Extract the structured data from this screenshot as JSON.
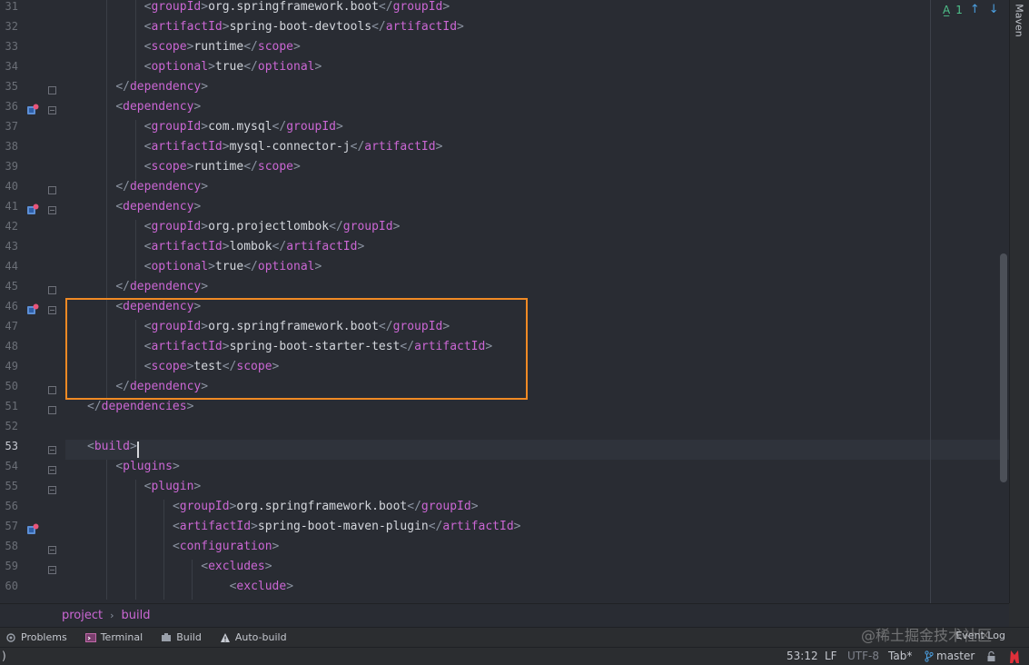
{
  "editor": {
    "line_numbers": [
      "31",
      "32",
      "33",
      "34",
      "35",
      "36",
      "37",
      "38",
      "39",
      "40",
      "41",
      "42",
      "43",
      "44",
      "45",
      "46",
      "47",
      "48",
      "49",
      "50",
      "51",
      "52",
      "53",
      "54",
      "55",
      "56",
      "57",
      "58",
      "59",
      "60"
    ],
    "current_line": "53",
    "lines": [
      {
        "indent": 2,
        "open": "groupId",
        "text": "org.springframework.boot"
      },
      {
        "indent": 2,
        "open": "artifactId",
        "text": "spring-boot-devtools"
      },
      {
        "indent": 2,
        "open": "scope",
        "text": "runtime"
      },
      {
        "indent": 2,
        "open": "optional",
        "text": "true"
      },
      {
        "indent": 1,
        "close_only": "dependency"
      },
      {
        "indent": 1,
        "open_only": "dependency"
      },
      {
        "indent": 2,
        "open": "groupId",
        "text": "com.mysql"
      },
      {
        "indent": 2,
        "open": "artifactId",
        "text": "mysql-connector-j"
      },
      {
        "indent": 2,
        "open": "scope",
        "text": "runtime"
      },
      {
        "indent": 1,
        "close_only": "dependency"
      },
      {
        "indent": 1,
        "open_only": "dependency"
      },
      {
        "indent": 2,
        "open": "groupId",
        "text": "org.projectlombok"
      },
      {
        "indent": 2,
        "open": "artifactId",
        "text": "lombok"
      },
      {
        "indent": 2,
        "open": "optional",
        "text": "true"
      },
      {
        "indent": 1,
        "close_only": "dependency"
      },
      {
        "indent": 1,
        "open_only": "dependency"
      },
      {
        "indent": 2,
        "open": "groupId",
        "text": "org.springframework.boot"
      },
      {
        "indent": 2,
        "open": "artifactId",
        "text": "spring-boot-starter-test"
      },
      {
        "indent": 2,
        "open": "scope",
        "text": "test"
      },
      {
        "indent": 1,
        "close_only": "dependency"
      },
      {
        "indent": 0,
        "close_only": "dependencies"
      },
      {
        "indent": 0,
        "empty": true
      },
      {
        "indent": 0,
        "open_only": "build",
        "caret": true
      },
      {
        "indent": 1,
        "open_only": "plugins"
      },
      {
        "indent": 2,
        "open_only": "plugin"
      },
      {
        "indent": 3,
        "open": "groupId",
        "text": "org.springframework.boot"
      },
      {
        "indent": 3,
        "open": "artifactId",
        "text": "spring-boot-maven-plugin"
      },
      {
        "indent": 3,
        "open_only": "configuration"
      },
      {
        "indent": 4,
        "open_only": "excludes"
      },
      {
        "indent": 5,
        "open_only": "exclude"
      }
    ],
    "inspection": {
      "count": "1",
      "up": "↑",
      "down": "↓"
    }
  },
  "right_tool_window": {
    "label": "Maven"
  },
  "breadcrumb": {
    "items": [
      "project",
      "build"
    ],
    "separator": "›"
  },
  "tool_windows": [
    {
      "label": "Problems",
      "icon": "problems-icon"
    },
    {
      "label": "Terminal",
      "icon": "terminal-icon"
    },
    {
      "label": "Build",
      "icon": "build-icon"
    },
    {
      "label": "Auto-build",
      "icon": "warning-icon"
    }
  ],
  "event_log": {
    "label": "Event Log"
  },
  "watermark": {
    "text": "@稀土掘金技术社区"
  },
  "statusbar": {
    "left": ")",
    "position": "53:12",
    "line_separator": "LF",
    "encoding": "UTF-8",
    "indent": "Tab*",
    "branch": "master"
  },
  "colors": {
    "highlight_box": "#f08a24",
    "tag_name": "#cb67d4",
    "bracket": "#8b93a1",
    "text": "#d4d7dd",
    "editor_bg": "#292c33"
  }
}
